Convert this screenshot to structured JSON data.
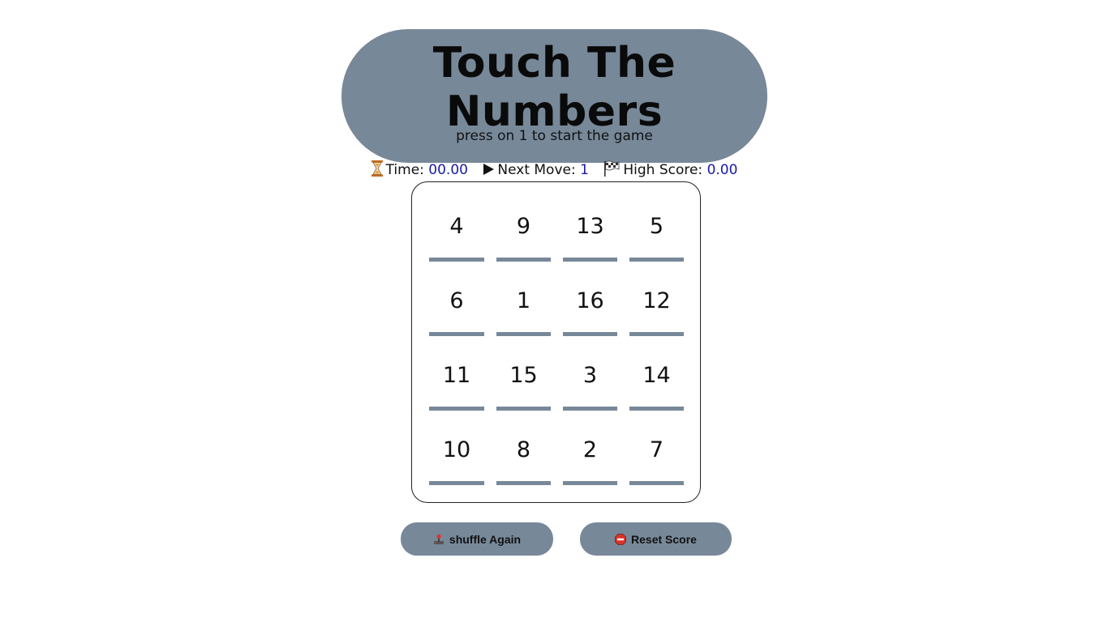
{
  "header": {
    "title": "Touch The Numbers",
    "subtitle": "press on 1 to start the game"
  },
  "stats": {
    "time_label": "Time:",
    "time_value": "00.00",
    "next_label": "Next Move:",
    "next_value": "1",
    "high_label": "High Score:",
    "high_value": "0.00",
    "icons": [
      "hourglass-icon",
      "play-icon",
      "checkered-flag-icon"
    ]
  },
  "board": {
    "cells": [
      "4",
      "9",
      "13",
      "5",
      "6",
      "1",
      "16",
      "12",
      "11",
      "15",
      "3",
      "14",
      "10",
      "8",
      "2",
      "7"
    ]
  },
  "buttons": {
    "shuffle_label": "shuffle Again",
    "reset_label": "Reset Score",
    "shuffle_icon": "joystick-icon",
    "reset_icon": "stop-icon"
  },
  "colors": {
    "accent": "#778899",
    "stat_value": "#1a1aa6",
    "background": "#ffffff"
  }
}
